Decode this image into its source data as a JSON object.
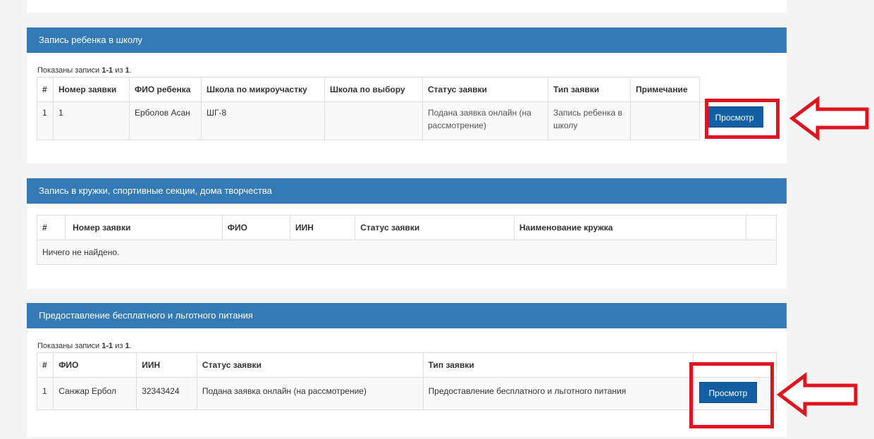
{
  "school_enrollment": {
    "title": "Запись ребенка в школу",
    "summary_prefix": "Показаны записи ",
    "summary_range": "1-1",
    "summary_mid": " из ",
    "summary_total": "1",
    "summary_suffix": ".",
    "columns": [
      "#",
      "Номер заявки",
      "ФИО ребенка",
      "Школа по микроучастку",
      "Школа по выбору",
      "Статус заявки",
      "Тип заявки",
      "Примечание",
      ""
    ],
    "rows": [
      {
        "index": "1",
        "number": "1",
        "child_name": "Ерболов Асан",
        "district_school": "ШГ-8",
        "chosen_school": "",
        "status": "Подана заявка онлайн (на рассмотрение)",
        "type": "Запись ребенка в школу",
        "note": "",
        "action_label": "Просмотр"
      }
    ]
  },
  "clubs": {
    "title": "Запись в кружки, спортивные секции, дома творчества",
    "columns": [
      "#",
      "Номер заявки",
      "ФИО",
      "ИИН",
      "Статус заявки",
      "Наименование кружка",
      ""
    ],
    "empty_message": "Ничего не найдено."
  },
  "meals": {
    "title": "Предоставление бесплатного и льготного питания",
    "summary_prefix": "Показаны записи ",
    "summary_range": "1-1",
    "summary_mid": " из ",
    "summary_total": "1",
    "summary_suffix": ".",
    "columns": [
      "#",
      "ФИО",
      "ИИН",
      "Статус заявки",
      "Тип заявки",
      ""
    ],
    "rows": [
      {
        "index": "1",
        "name": "Санжар Ербол",
        "iin": "32343424",
        "status": "Подана заявка онлайн (на рассмотрение)",
        "type": "Предоставление бесплатного и льготного питания",
        "action_label": "Просмотр"
      }
    ]
  },
  "annotation_color": "#e0141e",
  "accent_color": "#337ab7",
  "button_color": "#125fa4"
}
